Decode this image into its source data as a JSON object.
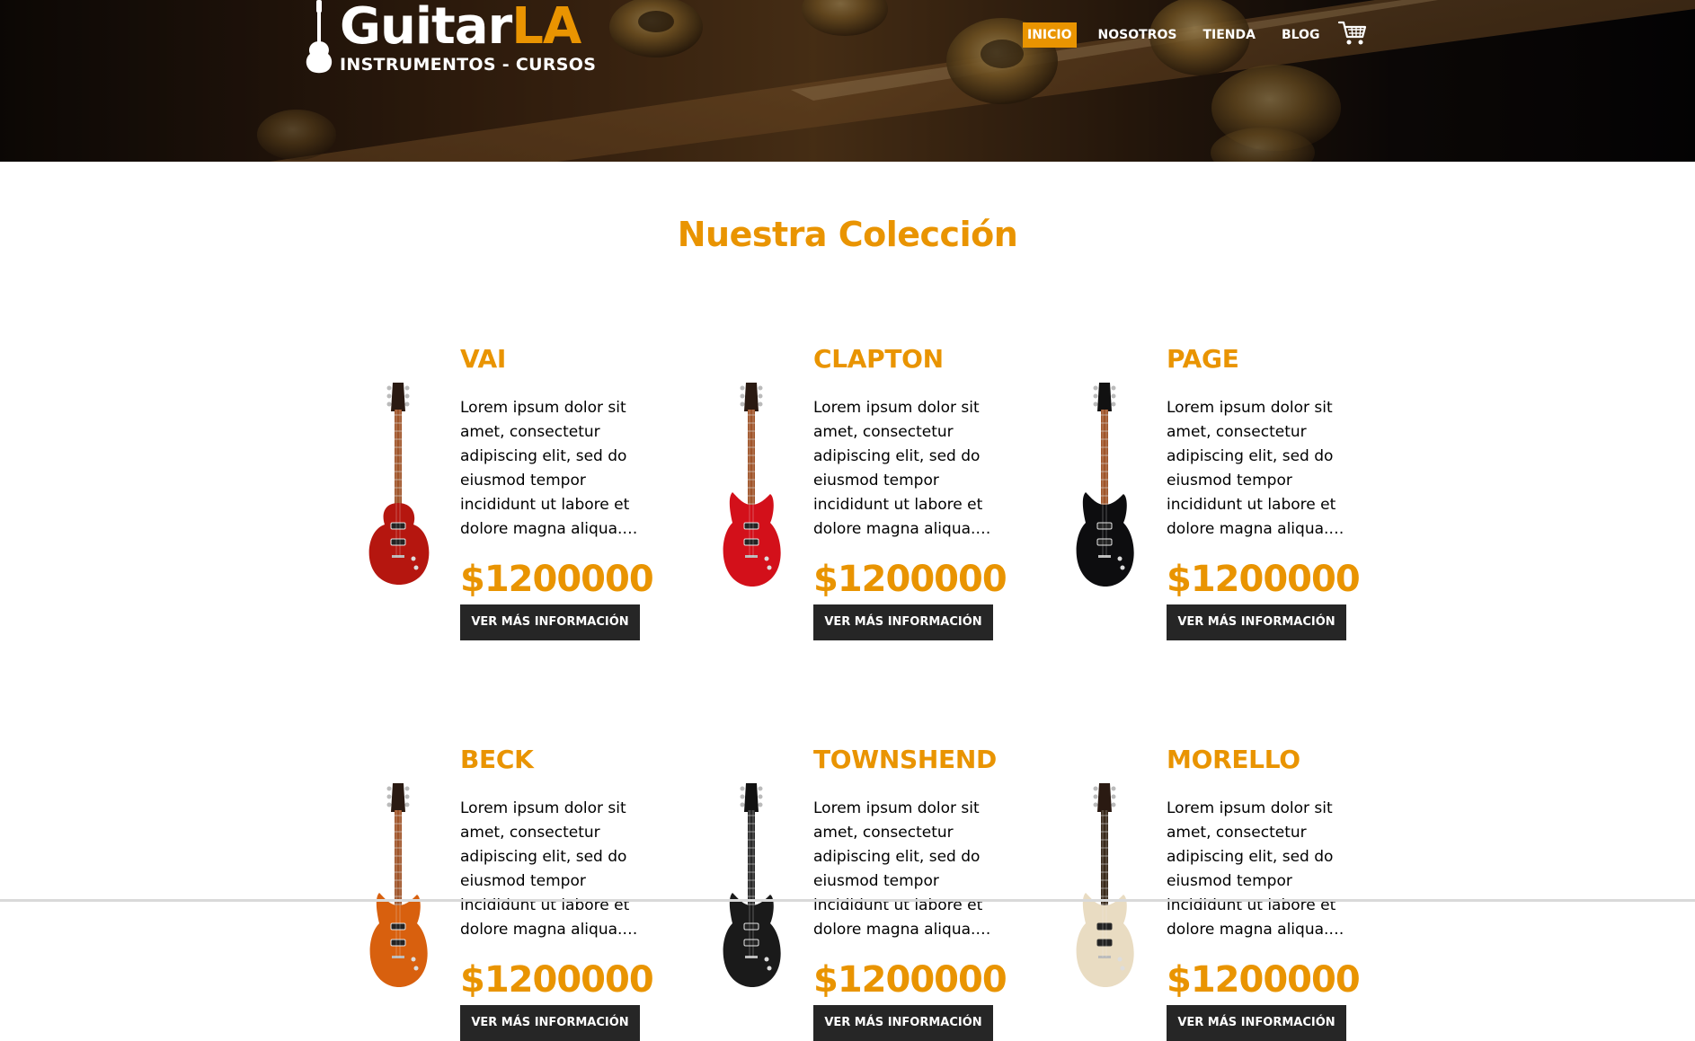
{
  "brand": {
    "name_main": "Guitar",
    "name_accent": "LA",
    "tagline": "INSTRUMENTOS - CURSOS"
  },
  "nav": {
    "items": [
      {
        "label": "INICIO",
        "active": true
      },
      {
        "label": "NOSOTROS",
        "active": false
      },
      {
        "label": "TIENDA",
        "active": false
      },
      {
        "label": "BLOG",
        "active": false
      }
    ],
    "cart_icon": "shopping-cart-icon"
  },
  "main": {
    "title": "Nuestra Colección",
    "products": [
      {
        "name": "VAI",
        "description": "Lorem ipsum dolor sit amet, consectetur adipiscing elit, sed do eiusmod tempor incididunt ut labore et dolore magna aliqua. U...",
        "price": "$1200000",
        "button_label": "VER MÁS INFORMACIÓN",
        "guitar_color": "#b5160f"
      },
      {
        "name": "CLAPTON",
        "description": "Lorem ipsum dolor sit amet, consectetur adipiscing elit, sed do eiusmod tempor incididunt ut labore et dolore magna aliqua. U...",
        "price": "$1200000",
        "button_label": "VER MÁS INFORMACIÓN",
        "guitar_color": "#d3101a"
      },
      {
        "name": "PAGE",
        "description": "Lorem ipsum dolor sit amet, consectetur adipiscing elit, sed do eiusmod tempor incididunt ut labore et dolore magna aliqua. U...",
        "price": "$1200000",
        "button_label": "VER MÁS INFORMACIÓN",
        "guitar_color": "#0d0d0f"
      },
      {
        "name": "BECK",
        "description": "Lorem ipsum dolor sit amet, consectetur adipiscing elit, sed do eiusmod tempor incididunt ut labore et dolore magna aliqua. U...",
        "price": "$1200000",
        "button_label": "VER MÁS INFORMACIÓN",
        "guitar_color": "#d8600e"
      },
      {
        "name": "TOWNSHEND",
        "description": "Lorem ipsum dolor sit amet, consectetur adipiscing elit, sed do eiusmod tempor incididunt ut labore et dolore magna aliqua. U...",
        "price": "$1200000",
        "button_label": "VER MÁS INFORMACIÓN",
        "guitar_color": "#1a1a1a"
      },
      {
        "name": "MORELLO",
        "description": "Lorem ipsum dolor sit amet, consectetur adipiscing elit, sed do eiusmod tempor incididunt ut labore et dolore magna aliqua. U...",
        "price": "$1200000",
        "button_label": "VER MÁS INFORMACIÓN",
        "guitar_color": "#e9dcc2"
      }
    ]
  },
  "colors": {
    "accent": "#e99401",
    "button_bg": "#262626",
    "text": "#000000"
  }
}
